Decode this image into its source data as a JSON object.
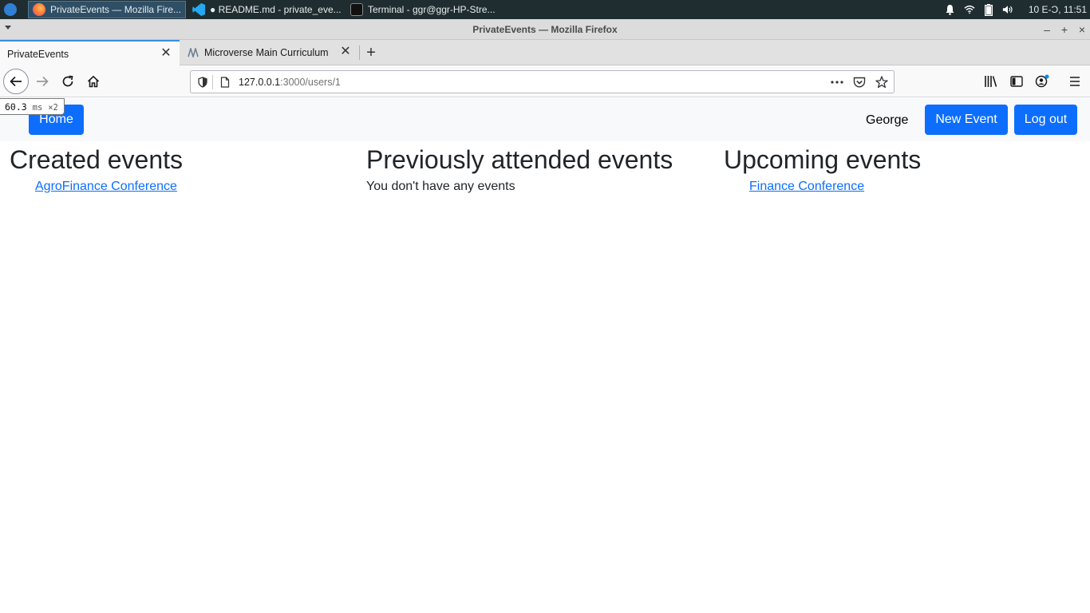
{
  "taskbar": {
    "items": [
      {
        "label": "PrivateEvents — Mozilla Fire..."
      },
      {
        "label": "● README.md - private_eve..."
      },
      {
        "label": "Terminal - ggr@ggr-HP-Stre..."
      }
    ],
    "clock": "10 E-Ɔ, 11:51"
  },
  "window": {
    "title": "PrivateEvents — Mozilla Firefox"
  },
  "tabs": [
    {
      "label": "PrivateEvents"
    },
    {
      "label": "Microverse Main Curriculum"
    }
  ],
  "urlbar": {
    "host": "127.0.0.1",
    "path": ":3000/users/1"
  },
  "perf": {
    "value": "60.3",
    "unit": "ms",
    "mult": "×2"
  },
  "app": {
    "home_label": "Home",
    "user_name": "George",
    "new_event_label": "New Event",
    "logout_label": "Log out",
    "colors": {
      "primary": "#0d6efd",
      "navbar_bg": "#f8f9fa"
    }
  },
  "sections": {
    "created": {
      "title": "Created events",
      "events": [
        "AgroFinance Conference"
      ]
    },
    "previous": {
      "title": "Previously attended events",
      "empty_text": "You don't have any events"
    },
    "upcoming": {
      "title": "Upcoming events",
      "events": [
        "Finance Conference"
      ]
    }
  }
}
